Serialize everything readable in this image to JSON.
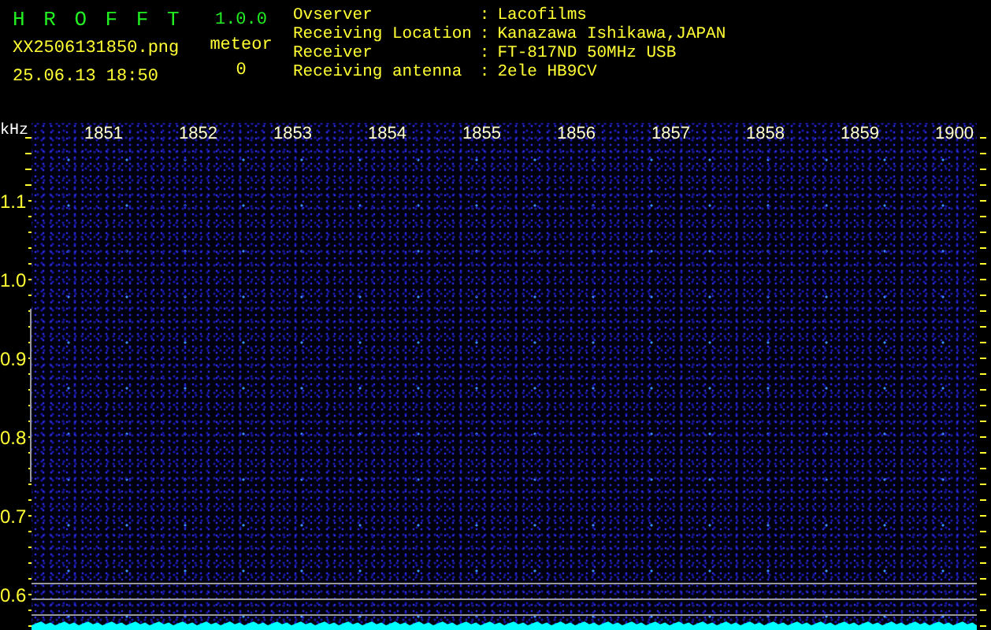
{
  "app": {
    "title": "H R O F F T",
    "version": "1.0.0",
    "filename": "XX2506131850.png",
    "datetime": "25.06.13 18:50",
    "meteor_label": "meteor",
    "meteor_count": "0"
  },
  "info": [
    {
      "label": "Ovserver",
      "separator": ":",
      "value": "Lacofilms"
    },
    {
      "label": "Receiving Location",
      "separator": ":",
      "value": "Kanazawa Ishikawa,JAPAN"
    },
    {
      "label": "Receiver",
      "separator": ":",
      "value": "FT-817ND 50MHz USB"
    },
    {
      "label": "Receiving antenna",
      "separator": ":",
      "value": "2ele HB9CV"
    }
  ],
  "spectrogram": {
    "unit": "kHz",
    "x_labels": [
      "1851",
      "1852",
      "1853",
      "1854",
      "1855",
      "1856",
      "1857",
      "1858",
      "1859",
      "1900"
    ],
    "y_labels": [
      "1.1",
      "1.0",
      "0.9",
      "0.8",
      "0.7",
      "0.6"
    ]
  }
}
